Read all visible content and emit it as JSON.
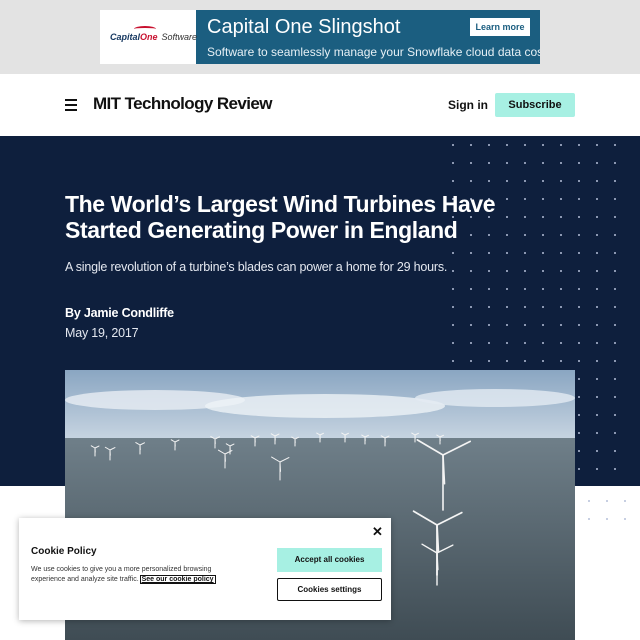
{
  "ad": {
    "brand_part1": "Capital",
    "brand_part2": "One",
    "brand_software": "Software",
    "title": "Capital One Slingshot",
    "subtitle": "Software to seamlessly manage your Snowflake cloud data costs.",
    "cta": "Learn more",
    "accent_color": "#1b5e80"
  },
  "header": {
    "menu_icon": "hamburger-menu-icon",
    "brand": "MIT Technology Review",
    "signin": "Sign in",
    "subscribe": "Subscribe",
    "subscribe_color": "#a7f0e3"
  },
  "article": {
    "headline": "The World’s Largest Wind Turbines Have Started Generating Power in England",
    "dek": "A single revolution of a turbine’s blades can power a home for 29 hours.",
    "byline_prefix": "By ",
    "author": "Jamie Condliffe",
    "date": "May 19, 2017",
    "hero_color": "#0e1f3d"
  },
  "cookie": {
    "title": "Cookie Policy",
    "text": "We use cookies to give you a more personalized browsing experience and analyze site traffic.",
    "link": "See our cookie policy",
    "accept": "Accept all cookies",
    "settings": "Cookies settings",
    "close_icon": "close-icon"
  }
}
